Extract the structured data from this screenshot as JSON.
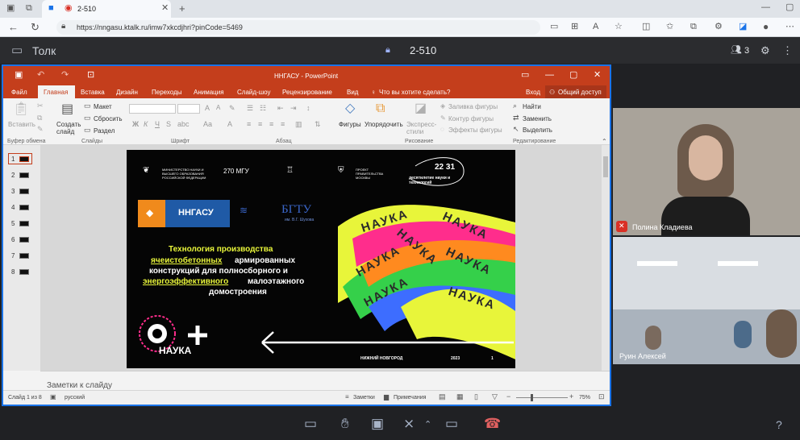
{
  "browser": {
    "tab_title": "2-510",
    "url": "https://nngasu.ktalk.ru/imw7xkcdjhri?pinCode=5469"
  },
  "app": {
    "brand": "Толк",
    "room_name": "2-510",
    "participants_count": "3"
  },
  "powerpoint": {
    "window_title": "ННГАСУ - PowerPoint",
    "tabs": [
      "Файл",
      "Главная",
      "Вставка",
      "Дизайн",
      "Переходы",
      "Анимация",
      "Слайд-шоу",
      "Рецензирование",
      "Вид"
    ],
    "search_hint": "Что вы хотите сделать?",
    "signin": "Вход",
    "share": "Общий доступ",
    "ribbon": {
      "paste": "Вставить",
      "clipboard_group": "Буфер обмена",
      "new_slide": "Создать слайд",
      "layout": "Макет",
      "reset": "Сбросить",
      "section": "Раздел",
      "slides_group": "Слайды",
      "font_group": "Шрифт",
      "paragraph_group": "Абзац",
      "shapes": "Фигуры",
      "arrange": "Упорядочить",
      "quick_styles": "Экспресс-стили",
      "fill": "Заливка фигуры",
      "outline": "Контур фигуры",
      "effects": "Эффекты фигуры",
      "drawing_group": "Рисование",
      "find": "Найти",
      "replace": "Заменить",
      "select": "Выделить",
      "editing_group": "Редактирование"
    },
    "slides": [
      "1",
      "2",
      "3",
      "4",
      "5",
      "6",
      "7",
      "8"
    ],
    "notes_placeholder": "Заметки к слайду",
    "status": {
      "slide_info": "Слайд 1 из 8",
      "language": "русский",
      "notes": "Заметки",
      "comments": "Примечания",
      "zoom": "75%"
    }
  },
  "slide": {
    "logo_ministry": "МИНИСТЕРСТВО НАУКИ И ВЫСШЕГО ОБРАЗОВАНИЯ РОССИЙСКОЙ ФЕДЕРАЦИИ",
    "logo_msu": "270 МГУ",
    "logo_project": "ПРОЕКТ ПРАВИТЕЛЬСТВА МОСКВЫ",
    "decade_numbers": "22 31",
    "decade_text": "десятилетие науки и технологий",
    "nngasu": "ННГАСУ",
    "bgtu": "БГТУ",
    "bgtu_sub": "им. В.Г. Шухова",
    "title_line1": "Технология производства",
    "title_highlight1": "ячеистобетонных",
    "title_line2_rest": " армированных",
    "title_line3": "конструкций для полносборного и",
    "title_highlight2": "энергоэффективного",
    "title_line4_rest": " малоэтажного",
    "title_line5": "домостроения",
    "nauka_word": "НАУКА",
    "festival_logo": "НАУКА",
    "city": "НИЖНИЙ НОВГОРОД",
    "year": "2023",
    "page": "1"
  },
  "participants": [
    {
      "name": "Полина Кладиева"
    },
    {
      "name": "Руин Алексей"
    }
  ],
  "colors": {
    "ppt_red": "#c43e1c",
    "accent_blue": "#1a73e8",
    "slide_yellow": "#e8f53a"
  }
}
